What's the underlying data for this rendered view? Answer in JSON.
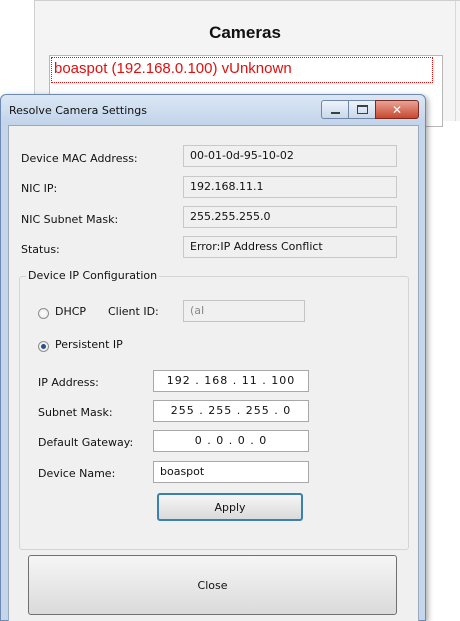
{
  "background_window": {
    "title": "Cameras",
    "camera_item": "boaspot (192.168.0.100) vUnknown"
  },
  "dialog": {
    "title": "Resolve Camera Settings",
    "window_buttons": {
      "minimize": "minimize-icon",
      "maximize": "maximize-icon",
      "close": "close-icon"
    },
    "close_glyph": "✕",
    "fields": {
      "mac_label": "Device MAC Address:",
      "mac_value": "00-01-0d-95-10-02",
      "nic_ip_label": "NIC IP:",
      "nic_ip_value": "192.168.11.1",
      "nic_mask_label": "NIC Subnet Mask:",
      "nic_mask_value": "255.255.255.0",
      "status_label": "Status:",
      "status_value": "Error:IP Address Conflict"
    },
    "ip_config": {
      "legend": "Device IP Configuration",
      "dhcp_label": "DHCP",
      "client_id_label": "Client ID:",
      "client_id_value": "(aI",
      "persistent_label": "Persistent IP",
      "mode": "persistent",
      "ip_label": "IP Address:",
      "ip_value": "192 . 168 . 11 . 100",
      "mask_label": "Subnet Mask:",
      "mask_value": "255 . 255 . 255 . 0",
      "gateway_label": "Default Gateway:",
      "gateway_value": "0 . 0 . 0 . 0",
      "name_label": "Device Name:",
      "name_value": "boaspot",
      "apply_label": "Apply"
    },
    "close_button_label": "Close"
  }
}
